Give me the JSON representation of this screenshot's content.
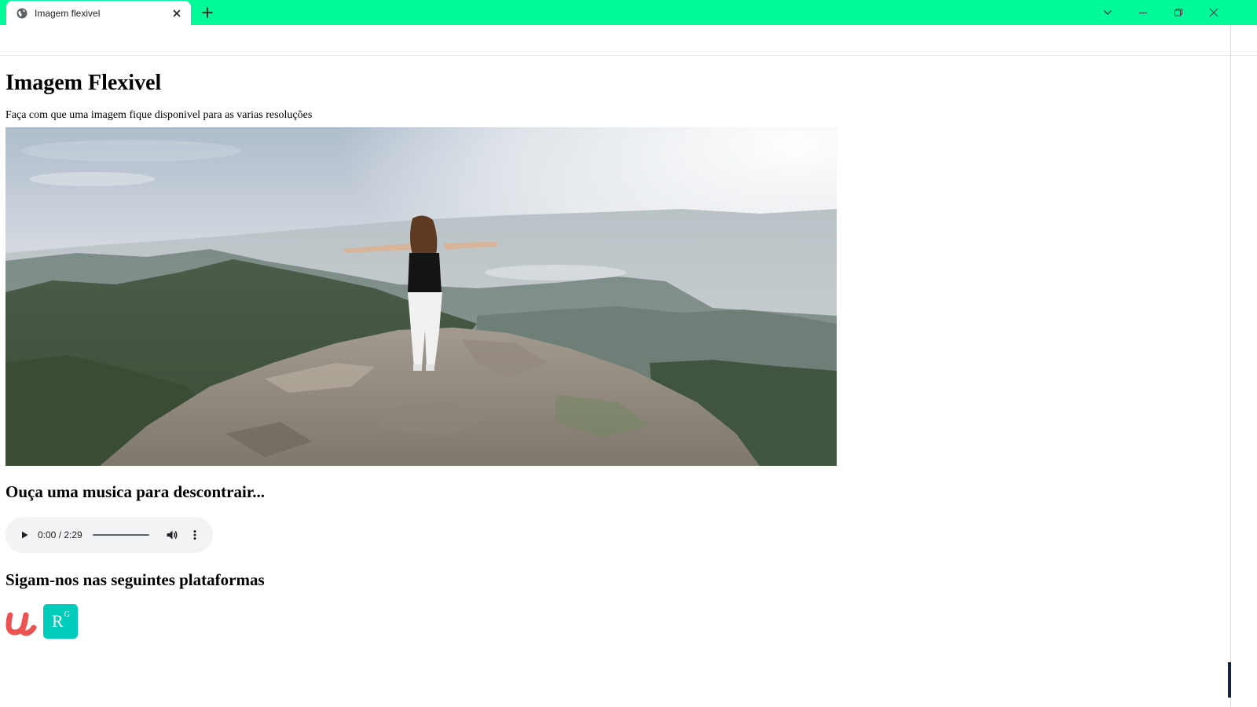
{
  "browser": {
    "tab_title": "Imagem flexivel",
    "accent_color": "#00fa9a",
    "icons": [
      "globe-icon",
      "close-icon",
      "plus-icon",
      "chevron-down-icon",
      "minimize-icon",
      "restore-icon",
      "close-window-icon"
    ]
  },
  "page": {
    "title": "Imagem Flexivel",
    "description": "Faça com que uma imagem fique disponivel para as varias resoluções",
    "hero_image": "woman-with-open-arms-on-mountain-summit",
    "music_heading": "Ouça uma musica para descontrair...",
    "audio": {
      "time": "0:00 / 2:29",
      "progress": 0,
      "icons": [
        "play-icon",
        "volume-icon",
        "more-options-icon"
      ]
    },
    "social_heading": "Sigam-nos nas seguintes plataformas",
    "social": {
      "udemy_logo": "u",
      "researchgate_logo": "R",
      "researchgate_logo_sup": "G",
      "udemy_color": "#ec5252",
      "researchgate_color": "#00ccbb"
    }
  }
}
